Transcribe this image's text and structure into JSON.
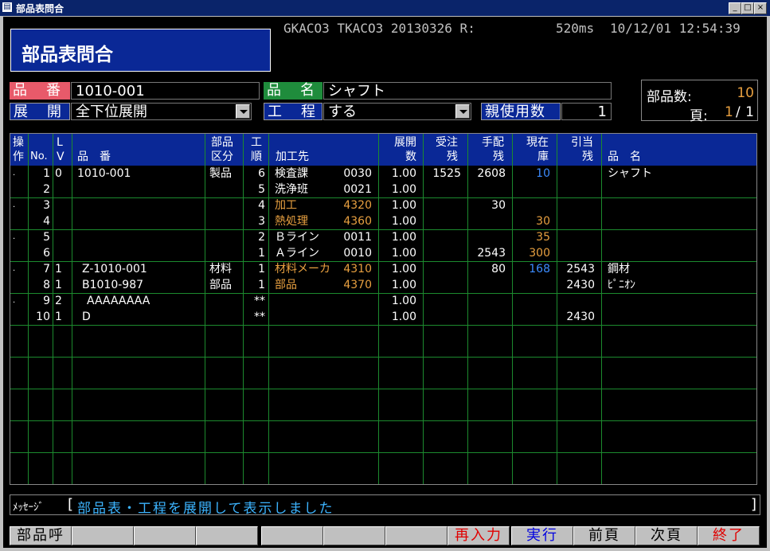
{
  "window": {
    "title": "部品表問合"
  },
  "header": {
    "screen_title": "部品表問合",
    "system_info": "GKACO3 TKACO3 20130326 R:",
    "response_time": "520ms",
    "datetime": "10/12/01 12:54:39"
  },
  "form": {
    "part_no_label": "品　番",
    "part_no_value": "1010-001",
    "expand_label": "展　開",
    "expand_value": "全下位展開",
    "part_name_label": "品　名",
    "part_name_value": "シャフト",
    "process_label": "工　程",
    "process_value": "する",
    "parent_usage_label": "親使用数",
    "parent_usage_value": "1"
  },
  "summary": {
    "part_count_label": "部品数:",
    "part_count_value": "10",
    "page_label": "頁:",
    "page_current": "1",
    "page_total": "1"
  },
  "grid": {
    "headers": {
      "op1": "操",
      "op2": "作",
      "no": "No.",
      "lv1": "L",
      "lv2": "V",
      "part_no": "品　番",
      "cat1": "部品",
      "cat2": "区分",
      "seq1": "工",
      "seq2": "順",
      "vendor": "加工先",
      "exp1": "展開",
      "exp2": "数",
      "ord1": "受注",
      "ord2": "残",
      "arr1": "手配",
      "arr2": "残",
      "stk1": "現在",
      "stk2": "庫",
      "alloc1": "引当",
      "alloc2": "残",
      "name": "品　名"
    },
    "rows": [
      {
        "op": ".",
        "no": "1",
        "lv": "0",
        "part": "1010-001",
        "cat": "製品",
        "seq": "6",
        "vendor": "検査課",
        "vcode": "0030",
        "vendor_color": "#ffffff",
        "exp": "1.00",
        "ord": "1525",
        "arr": "2608",
        "stock": "10",
        "stock_color": "#3c8cff",
        "alloc": "",
        "name": "シャフト"
      },
      {
        "op": "",
        "no": "2",
        "lv": "",
        "part": "",
        "cat": "",
        "seq": "5",
        "vendor": "洗浄班",
        "vcode": "0021",
        "vendor_color": "#ffffff",
        "exp": "1.00",
        "ord": "",
        "arr": "",
        "stock": "",
        "stock_color": "#ffffff",
        "alloc": "",
        "name": ""
      },
      {
        "op": ".",
        "no": "3",
        "lv": "",
        "part": "",
        "cat": "",
        "seq": "4",
        "vendor": "加工",
        "vcode": "4320",
        "vendor_color": "#e8a040",
        "exp": "1.00",
        "ord": "",
        "arr": "30",
        "stock": "",
        "stock_color": "#ffffff",
        "alloc": "",
        "name": ""
      },
      {
        "op": "",
        "no": "4",
        "lv": "",
        "part": "",
        "cat": "",
        "seq": "3",
        "vendor": "熱処理",
        "vcode": "4360",
        "vendor_color": "#e8a040",
        "exp": "1.00",
        "ord": "",
        "arr": "",
        "stock": "30",
        "stock_color": "#e8a040",
        "alloc": "",
        "name": ""
      },
      {
        "op": ".",
        "no": "5",
        "lv": "",
        "part": "",
        "cat": "",
        "seq": "2",
        "vendor": "Ｂライン",
        "vcode": "0011",
        "vendor_color": "#ffffff",
        "exp": "1.00",
        "ord": "",
        "arr": "",
        "stock": "35",
        "stock_color": "#e8a040",
        "alloc": "",
        "name": ""
      },
      {
        "op": "",
        "no": "6",
        "lv": "",
        "part": "",
        "cat": "",
        "seq": "1",
        "vendor": "Ａライン",
        "vcode": "0010",
        "vendor_color": "#ffffff",
        "exp": "1.00",
        "ord": "",
        "arr": "2543",
        "stock": "300",
        "stock_color": "#e8a040",
        "alloc": "",
        "name": ""
      },
      {
        "op": ".",
        "no": "7",
        "lv": "1",
        "part": "Z-1010-001",
        "cat": "材料",
        "seq": "1",
        "vendor": "材料メーカ",
        "vcode": "4310",
        "vendor_color": "#e8a040",
        "exp": "1.00",
        "ord": "",
        "arr": "80",
        "stock": "168",
        "stock_color": "#3c8cff",
        "alloc": "2543",
        "name": "鋼材"
      },
      {
        "op": "",
        "no": "8",
        "lv": "1",
        "part": "B1010-987",
        "cat": "部品",
        "seq": "1",
        "vendor": "部品",
        "vcode": "4370",
        "vendor_color": "#e8a040",
        "exp": "1.00",
        "ord": "",
        "arr": "",
        "stock": "",
        "stock_color": "#ffffff",
        "alloc": "2430",
        "name": "ﾋﾟﾆｵﾝ"
      },
      {
        "op": ".",
        "no": "9",
        "lv": "2",
        "part": "AAAAAAAA",
        "cat": "",
        "seq": "**",
        "vendor": "",
        "vcode": "",
        "vendor_color": "#ffffff",
        "exp": "1.00",
        "ord": "",
        "arr": "",
        "stock": "",
        "stock_color": "#ffffff",
        "alloc": "",
        "name": ""
      },
      {
        "op": "",
        "no": "10",
        "lv": "1",
        "part": "D",
        "cat": "",
        "seq": "**",
        "vendor": "",
        "vcode": "",
        "vendor_color": "#ffffff",
        "exp": "1.00",
        "ord": "",
        "arr": "",
        "stock": "",
        "stock_color": "#ffffff",
        "alloc": "2430",
        "name": ""
      }
    ]
  },
  "message": {
    "label": "ﾒｯｾｰｼﾞ",
    "open": "[",
    "text": "部品表・工程を展開して表示しました",
    "close": "]"
  },
  "function_keys": [
    "部品呼",
    "",
    "",
    "",
    "",
    "",
    "",
    "再入力",
    "実行",
    "前頁",
    "次頁",
    "終了"
  ],
  "function_key_colors": [
    "#000000",
    "#000000",
    "#000000",
    "#000000",
    "#000000",
    "#000000",
    "#000000",
    "#e00000",
    "#0000e0",
    "#000000",
    "#000000",
    "#e00000"
  ],
  "colors": {
    "header_bg": "#0a2896",
    "grid_line": "#1c8a2e",
    "label_red": "#e85a6a",
    "label_green": "#1f8c3c",
    "label_blue": "#0a2896",
    "accent_orange": "#e8a040",
    "accent_blue": "#3c8cff",
    "message_text": "#3cb4ff"
  }
}
